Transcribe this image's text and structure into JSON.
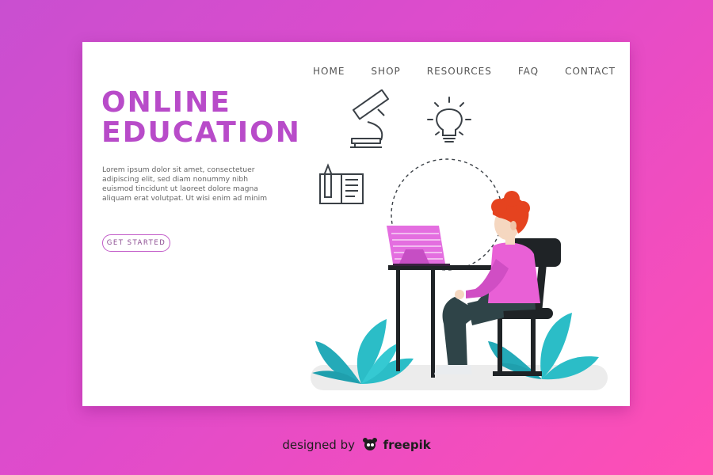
{
  "nav": {
    "items": [
      {
        "label": "HOME",
        "name": "nav-home"
      },
      {
        "label": "SHOP",
        "name": "nav-shop"
      },
      {
        "label": "RESOURCES",
        "name": "nav-resources"
      },
      {
        "label": "FAQ",
        "name": "nav-faq"
      },
      {
        "label": "CONTACT",
        "name": "nav-contact"
      }
    ]
  },
  "hero": {
    "title_line1": "ONLINE",
    "title_line2": "EDUCATION",
    "body": "Lorem ipsum dolor sit amet, consectetuer adipiscing elit, sed diam nonummy nibh euismod tincidunt ut laoreet dolore magna aliquam erat volutpat. Ut wisi enim ad minim",
    "cta_label": "GET STARTED"
  },
  "illustration": {
    "icons": [
      "microscope-icon",
      "lightbulb-icon",
      "notebook-pencil-icon"
    ],
    "scene": "person-at-laptop"
  },
  "footer": {
    "designed_by": "designed by",
    "brand": "freepik"
  },
  "colors": {
    "accent": "#b84bc9",
    "background_start": "#c94fd0",
    "background_end": "#ff4fb4",
    "plant": "#2bbdc7",
    "laptop": "#e46ee0",
    "hair": "#e5431f"
  }
}
